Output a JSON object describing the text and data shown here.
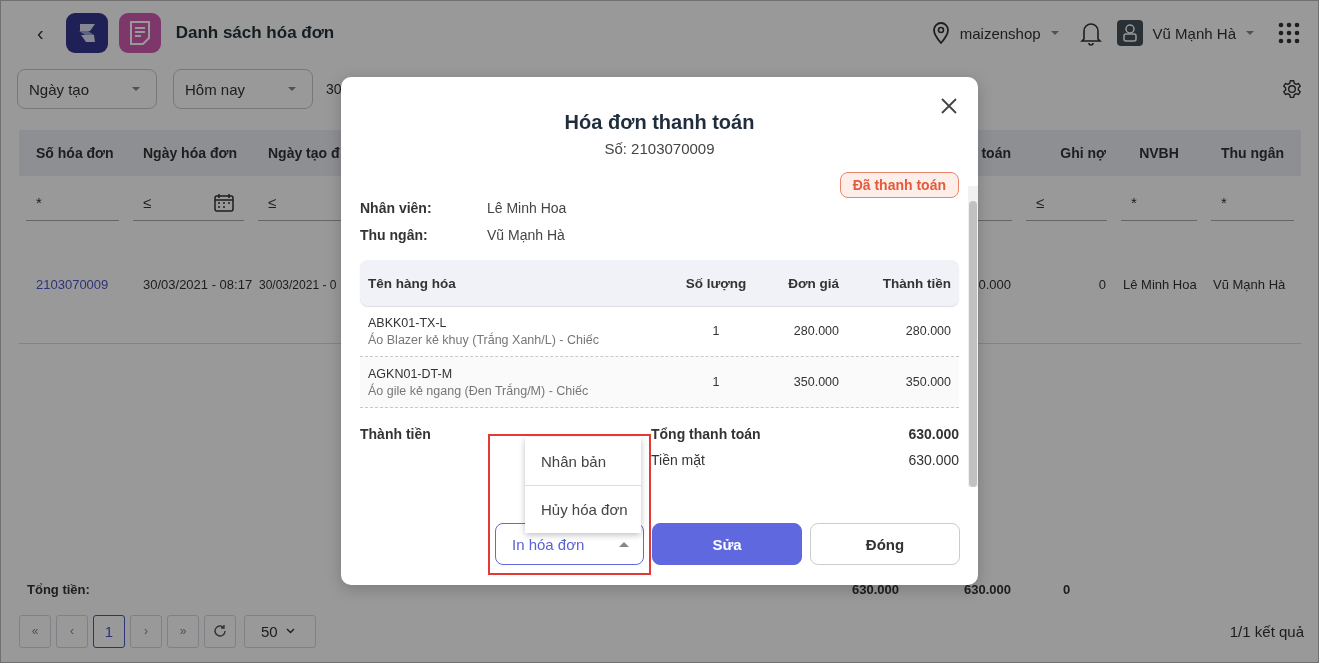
{
  "header": {
    "back": "‹",
    "title": "Danh sách hóa đơn",
    "location": "maizenshop",
    "user": "Vũ Mạnh Hà"
  },
  "filters": {
    "selects": [
      {
        "label": "Ngày tạo"
      },
      {
        "label": "Hôm nay"
      }
    ],
    "date_range": "30"
  },
  "table": {
    "columns": [
      {
        "label": "Số hóa đơn",
        "link": true
      },
      {
        "label": "Ngày hóa đơn",
        "link": false
      },
      {
        "label": "Ngày tạo đ",
        "link": false
      },
      {
        "label": "toán",
        "link": false
      },
      {
        "label": "Ghi nợ",
        "link": false
      },
      {
        "label": "NVBH",
        "link": false
      },
      {
        "label": "Thu ngân",
        "link": false
      }
    ],
    "filter_row": [
      {
        "kind": "text",
        "value": "*"
      },
      {
        "kind": "date",
        "value": "≤"
      },
      {
        "kind": "text",
        "value": "≤"
      },
      {
        "kind": "blank"
      },
      {
        "kind": "text",
        "value": "≤"
      },
      {
        "kind": "text",
        "value": "*"
      },
      {
        "kind": "text",
        "value": "*"
      }
    ],
    "rows": [
      {
        "cells": [
          "2103070009",
          "30/03/2021 - 08:17",
          "30/03/2021 - 0",
          "0.000",
          "0",
          "Lê Minh Hoa",
          "Vũ Mạnh Hà"
        ]
      }
    ],
    "totals": {
      "label": "Tổng tiền:",
      "values": [
        "630.000",
        "630.000",
        "0"
      ]
    }
  },
  "pagination": {
    "first": "«",
    "prev": "‹",
    "pages": [
      {
        "label": "1",
        "selected": true
      }
    ],
    "next": "›",
    "last": "»",
    "page_size": "50",
    "result": "1/1 kết quả"
  },
  "modal": {
    "title": "Hóa đơn thanh toán",
    "number": "Số: 2103070009",
    "status": "Đã thanh toán",
    "info": [
      {
        "label": "Nhân viên:",
        "value": "Lê Minh Hoa"
      },
      {
        "label": "Thu ngân:",
        "value": "Vũ Mạnh Hà"
      }
    ],
    "items": {
      "columns": [
        "Tên hàng hóa",
        "Số lượng",
        "Đơn giá",
        "Thành tiền"
      ],
      "rows": [
        {
          "code": "ABKK01-TX-L",
          "name": "Áo Blazer kẻ khuy (Trắng Xanh/L) - Chiếc",
          "qty": "1",
          "price": "280.000",
          "amount": "280.000"
        },
        {
          "code": "AGKN01-DT-M",
          "name": "Áo gile kẻ ngang (Đen Trắng/M) - Chiếc",
          "qty": "1",
          "price": "350.000",
          "amount": "350.000"
        }
      ]
    },
    "summary": {
      "left_label": "Thành tiền",
      "lines": [
        {
          "kind": "total",
          "label": "Tổng thanh toán",
          "value": "630.000"
        },
        {
          "kind": "line",
          "label": "Tiền mặt",
          "value": "630.000"
        }
      ]
    },
    "buttons": [
      {
        "kind": "dropdown",
        "label": "In hóa đơn",
        "expanded": true,
        "highlighted": true,
        "menu": [
          "Nhân bản",
          "Hủy hóa đơn"
        ]
      },
      {
        "kind": "primary",
        "label": "Sửa"
      },
      {
        "kind": "secondary",
        "label": "Đóng"
      }
    ]
  }
}
